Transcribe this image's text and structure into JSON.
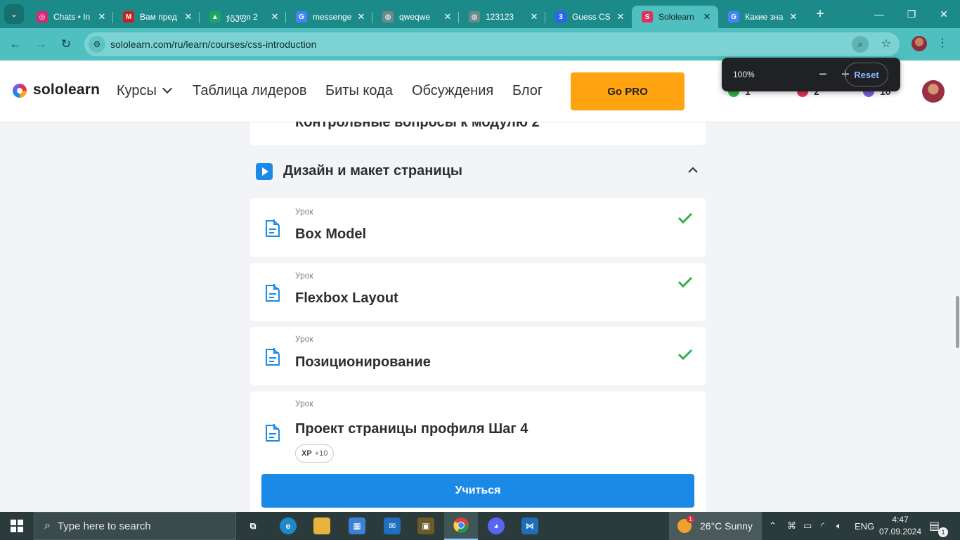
{
  "browser": {
    "tabs": [
      {
        "title": "Chats • In",
        "icon": "instagram-icon",
        "color": "#d62976",
        "glyph": "◎"
      },
      {
        "title": "Вам пред",
        "icon": "gmail-icon",
        "color": "#c5221f",
        "glyph": "M"
      },
      {
        "title": "ჯგუფი 2",
        "icon": "google-drive-icon",
        "color": "#1fa463",
        "glyph": "▲"
      },
      {
        "title": "messenge",
        "icon": "google-icon",
        "color": "#4285f4",
        "glyph": "G"
      },
      {
        "title": "qweqwe",
        "icon": "globe-icon",
        "color": "#6b8a8a",
        "glyph": "◍"
      },
      {
        "title": "123123",
        "icon": "globe-icon",
        "color": "#6b8a8a",
        "glyph": "◍"
      },
      {
        "title": "Guess CSS",
        "icon": "css-icon",
        "color": "#2965f1",
        "glyph": "3"
      },
      {
        "title": "Sololearn",
        "icon": "sololearn-icon",
        "color": "#e3305a",
        "glyph": "S"
      },
      {
        "title": "Какие зна",
        "icon": "google-icon",
        "color": "#4285f4",
        "glyph": "G"
      }
    ],
    "url": "sololearn.com/ru/learn/courses/css-introduction"
  },
  "zoom_popup": {
    "value": "100%",
    "minus": "−",
    "plus": "+",
    "reset": "Reset"
  },
  "header": {
    "logo": "sololearn",
    "nav": {
      "courses": "Курсы",
      "leaderboard": "Таблица лидеров",
      "code_bits": "Биты кода",
      "discussions": "Обсуждения",
      "blog": "Блог"
    },
    "go_pro": "Go PRO",
    "stats": [
      {
        "value": "1",
        "color": "#2fb34a"
      },
      {
        "value": "2",
        "color": "#e3305a"
      },
      {
        "value": "10",
        "color": "#7c5ce0"
      }
    ]
  },
  "content": {
    "prev_item_title": "Контрольные вопросы к модулю 2",
    "module_title": "Дизайн и макет страницы",
    "lessons": [
      {
        "kind": "Урок",
        "name": "Box Model",
        "completed": true
      },
      {
        "kind": "Урок",
        "name": "Flexbox Layout",
        "completed": true
      },
      {
        "kind": "Урок",
        "name": "Позиционирование",
        "completed": true
      },
      {
        "kind": "Урок",
        "name": "Проект страницы профиля Шаг 4",
        "completed": false,
        "xp_label": "XP",
        "xp_value": "+10"
      }
    ],
    "learn_button": "Учиться"
  },
  "taskbar": {
    "search_placeholder": "Type here to search",
    "weather": "26°C  Sunny",
    "weather_badge": "1",
    "language": "ENG",
    "time": "4:47",
    "date": "07.09.2024",
    "notifications": "1"
  },
  "colors": {
    "chrome_frame": "#1d8a8a",
    "chrome_toolbar": "#4fbfbf",
    "accent_blue": "#1a8ae6",
    "go_pro": "#ffa310",
    "check_green": "#2fb34a"
  }
}
